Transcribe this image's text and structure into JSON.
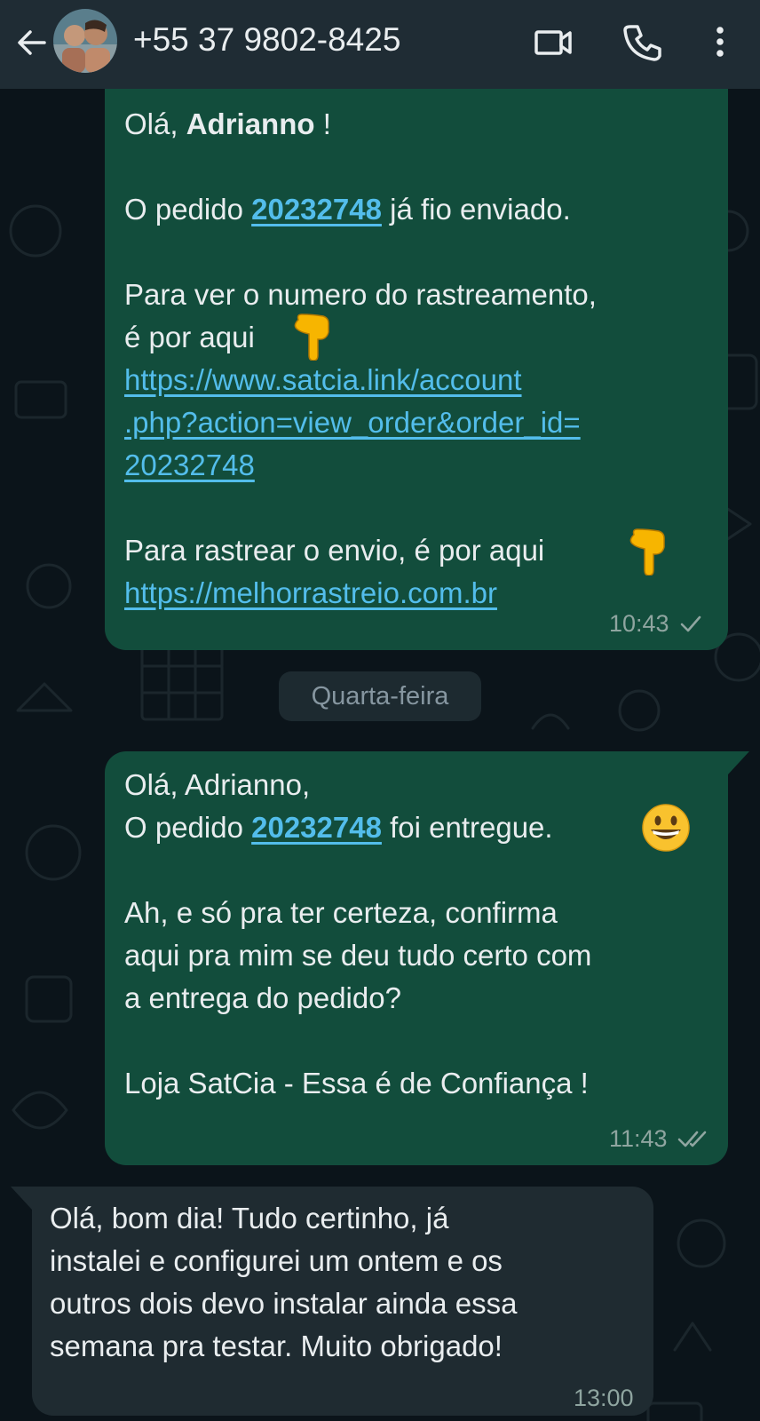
{
  "header": {
    "contact_name": "+55 37 9802-8425",
    "back_icon": "arrow-left-icon",
    "video_icon": "video-camera-icon",
    "call_icon": "phone-icon",
    "menu_icon": "more-vertical-icon"
  },
  "messages": [
    {
      "direction": "outgoing",
      "greeting_prefix": "Olá, ",
      "greeting_name": "Adrianno",
      "greeting_suffix": " !",
      "order_prefix": "O pedido ",
      "order_number": "20232748",
      "order_suffix": " já fio enviado.",
      "tracking_line1": "Para ver o numero do rastreamento,",
      "tracking_line2": "é por aqui",
      "tracking_link_line1": "https://www.satcia.link/account",
      "tracking_link_line2": ".php?action=view_order&order_id=",
      "tracking_link_line3": "20232748",
      "track_shipment": "Para rastrear o envio, é por aqui",
      "track_link": "https://melhorrastreio.com.br",
      "time": "10:43",
      "status": "sent"
    },
    {
      "direction": "outgoing",
      "greeting": "Olá, Adrianno,",
      "order_prefix": "O pedido ",
      "order_number": "20232748",
      "order_suffix": " foi entregue.",
      "confirm_line1": "Ah, e só pra ter certeza, confirma",
      "confirm_line2": "aqui pra mim se deu tudo certo com",
      "confirm_line3": "a entrega do pedido?",
      "signature": "Loja SatCia - Essa é de Confiança !",
      "time": "11:43",
      "status": "delivered"
    },
    {
      "direction": "incoming",
      "line1": "Olá, bom dia! Tudo certinho, já",
      "line2": "instalei e configurei um ontem e os",
      "line3": "outros dois devo instalar ainda essa",
      "line4": "semana pra testar. Muito obrigado!",
      "time": "13:00"
    }
  ],
  "day_divider": "Quarta-feira",
  "colors": {
    "header_bg": "#1f2c34",
    "chat_bg": "#0b141a",
    "outgoing_bubble": "#124d3c",
    "incoming_bubble": "#1f2b31",
    "link": "#53bdeb",
    "text": "#e9edef"
  }
}
